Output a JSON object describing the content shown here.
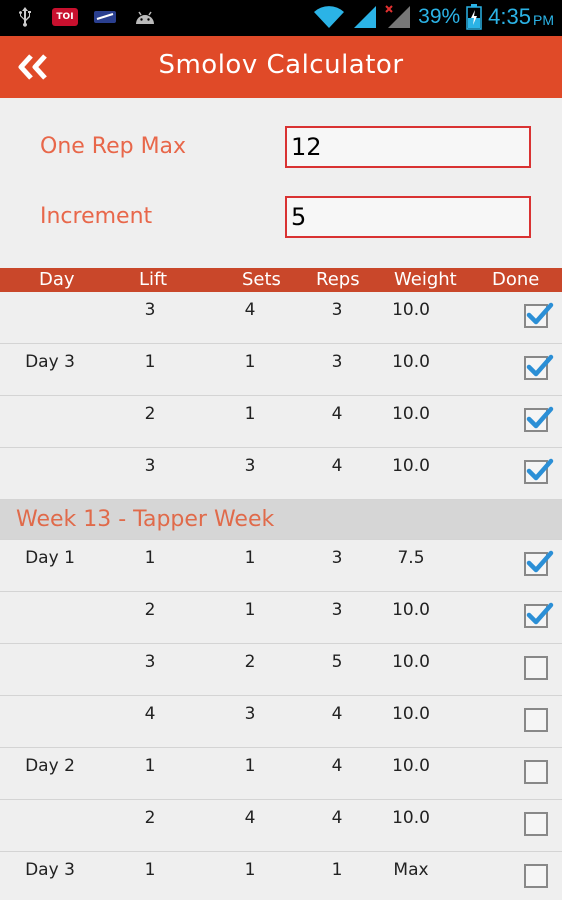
{
  "status_bar": {
    "left_icons": [
      "usb-icon",
      "toi-app-icon",
      "notification-icon",
      "android-icon"
    ],
    "toi_label": "TOI",
    "battery_percent": "39%",
    "time": "4:35",
    "ampm": "PM"
  },
  "header": {
    "title": "Smolov Calculator"
  },
  "form": {
    "one_rep_max_label": "One Rep Max",
    "one_rep_max_value": "12",
    "increment_label": "Increment",
    "increment_value": "5"
  },
  "table": {
    "columns": [
      "Day",
      "Lift",
      "Sets",
      "Reps",
      "Weight",
      "Done"
    ],
    "rows": [
      {
        "type": "entry",
        "day": "",
        "lift": "3",
        "sets": "4",
        "reps": "3",
        "weight": "10.0",
        "done": true
      },
      {
        "type": "entry",
        "day": "Day 3",
        "lift": "1",
        "sets": "1",
        "reps": "3",
        "weight": "10.0",
        "done": true
      },
      {
        "type": "entry",
        "day": "",
        "lift": "2",
        "sets": "1",
        "reps": "4",
        "weight": "10.0",
        "done": true
      },
      {
        "type": "entry",
        "day": "",
        "lift": "3",
        "sets": "3",
        "reps": "4",
        "weight": "10.0",
        "done": true
      },
      {
        "type": "week",
        "title": "Week 13 - Tapper Week"
      },
      {
        "type": "entry",
        "day": "Day 1",
        "lift": "1",
        "sets": "1",
        "reps": "3",
        "weight": "7.5",
        "done": true
      },
      {
        "type": "entry",
        "day": "",
        "lift": "2",
        "sets": "1",
        "reps": "3",
        "weight": "10.0",
        "done": true
      },
      {
        "type": "entry",
        "day": "",
        "lift": "3",
        "sets": "2",
        "reps": "5",
        "weight": "10.0",
        "done": false
      },
      {
        "type": "entry",
        "day": "",
        "lift": "4",
        "sets": "3",
        "reps": "4",
        "weight": "10.0",
        "done": false
      },
      {
        "type": "entry",
        "day": "Day 2",
        "lift": "1",
        "sets": "1",
        "reps": "4",
        "weight": "10.0",
        "done": false
      },
      {
        "type": "entry",
        "day": "",
        "lift": "2",
        "sets": "4",
        "reps": "4",
        "weight": "10.0",
        "done": false
      },
      {
        "type": "entry",
        "day": "Day 3",
        "lift": "1",
        "sets": "1",
        "reps": "1",
        "weight": "Max",
        "done": false
      }
    ]
  },
  "colors": {
    "accent": "#e04a28",
    "table_header": "#c9472a",
    "label": "#e8674a",
    "check": "#2b8fd6"
  }
}
